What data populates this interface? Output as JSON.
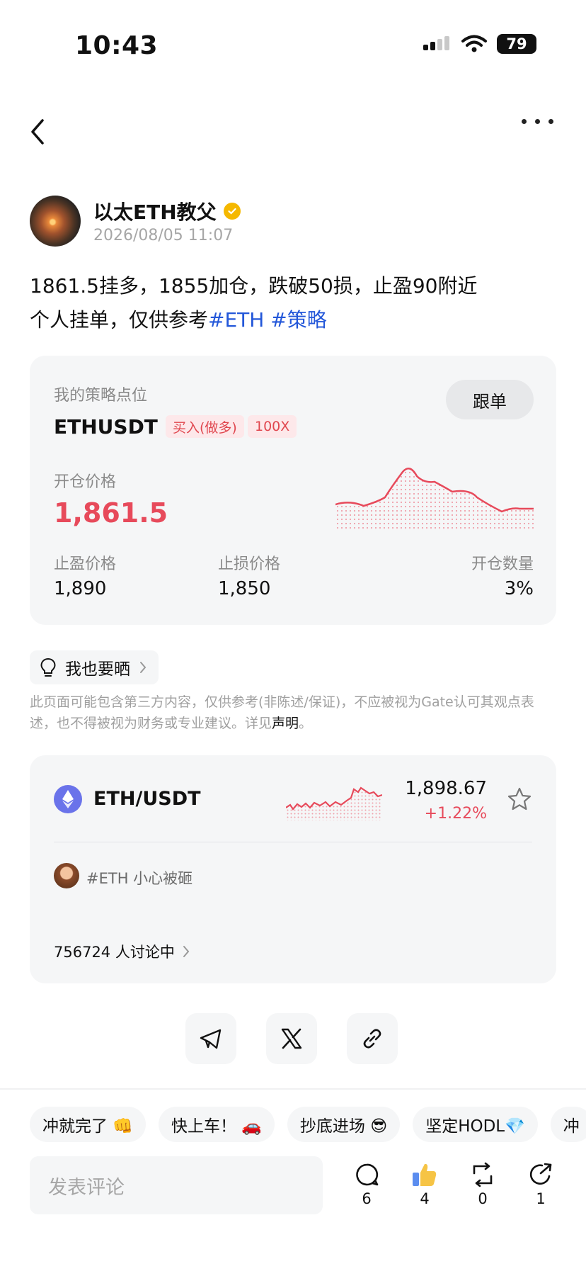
{
  "status_bar": {
    "time": "10:43",
    "battery": "79"
  },
  "author": {
    "name": "以太ETH教父",
    "time": "2026/08/05 11:07"
  },
  "post": {
    "line1": "1861.5挂多，1855加仓，跌破50损，止盈90附近",
    "line2_text": "个人挂单，仅供参考",
    "tags": [
      "#ETH",
      "#策略"
    ]
  },
  "strategy_card": {
    "label": "我的策略点位",
    "pair": "ETHUSDT",
    "side_badge": "买入(做多)",
    "leverage_badge": "100X",
    "follow_button": "跟单",
    "open_price_label": "开仓价格",
    "open_price": "1,861.5",
    "take_profit_label": "止盈价格",
    "take_profit": "1,890",
    "stop_loss_label": "止损价格",
    "stop_loss": "1,850",
    "position_label": "开仓数量",
    "position": "3%"
  },
  "share_pill": {
    "label": "我也要晒"
  },
  "disclaimer": {
    "text": "此页面可能包含第三方内容，仅供参考(非陈述/保证)，不应被视为Gate认可其观点表述，也不得被视为财务或专业建议。详见",
    "link": "声明",
    "end": "。"
  },
  "market_card": {
    "pair": "ETH/USDT",
    "price": "1,898.67",
    "change": "+1.22%",
    "topic": "#ETH 小心被砸",
    "discussion": "756724 人讨论中"
  },
  "quick_replies": [
    "冲就完了 👊",
    "快上车！ 🚗",
    "抄底进场 😎",
    "坚定HODL💎",
    "冲"
  ],
  "comment": {
    "placeholder": "发表评论"
  },
  "actions": {
    "comments": "6",
    "likes": "4",
    "reposts": "0",
    "shares": "1"
  },
  "colors": {
    "accent_red": "#e74a5b",
    "tag_blue": "#2357d9",
    "card_bg": "#f5f6f7"
  },
  "icons": [
    "back-icon",
    "more-icon",
    "verified-icon",
    "bulb-icon",
    "chevron-right-icon",
    "eth-icon",
    "star-icon",
    "telegram-icon",
    "x-icon",
    "link-icon",
    "comment-icon",
    "like-icon",
    "repost-icon",
    "share-icon"
  ]
}
